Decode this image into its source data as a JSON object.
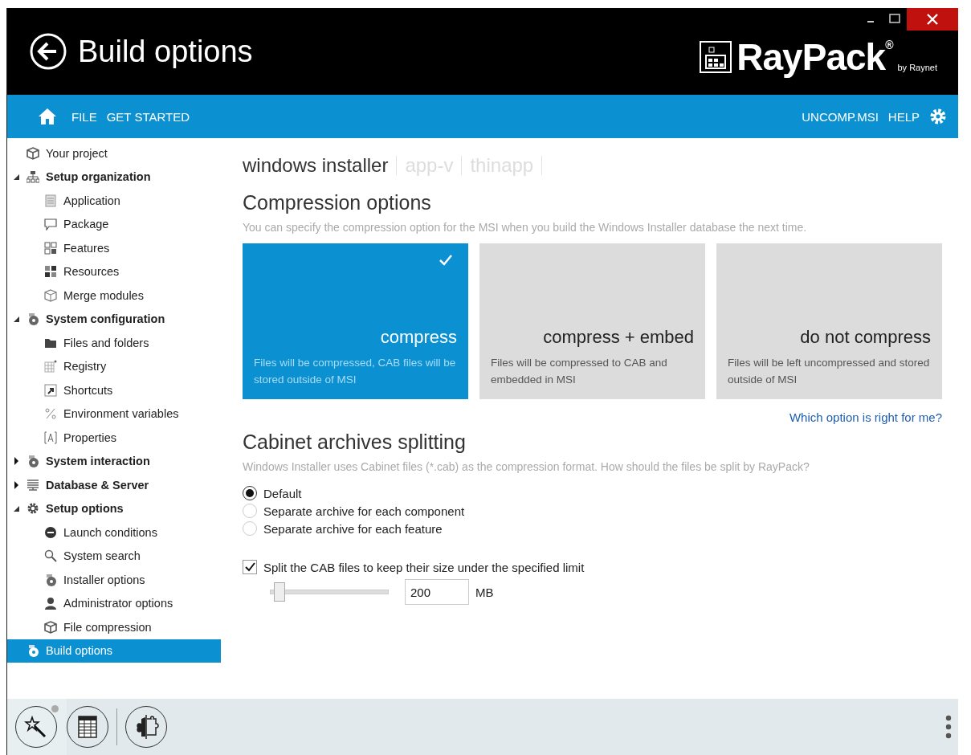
{
  "window": {
    "title": "Build options",
    "logo": "RayPack$^{®}$",
    "logo_byline": "by Raynet"
  },
  "nav": {
    "left": [
      "FILE",
      "GET STARTED"
    ],
    "right": [
      "UNCOMP.MSI",
      "HELP"
    ]
  },
  "sidebar": {
    "items": [
      {
        "label": "Your project",
        "bold": false,
        "selected": false
      },
      {
        "label": "Setup organization",
        "bold": true,
        "expanded": true,
        "selected": false,
        "children": [
          {
            "label": "Application",
            "selected": false
          },
          {
            "label": "Package",
            "selected": false
          },
          {
            "label": "Features",
            "selected": false
          },
          {
            "label": "Resources",
            "selected": false
          },
          {
            "label": "Merge modules",
            "selected": false
          }
        ]
      },
      {
        "label": "System configuration",
        "bold": true,
        "expanded": true,
        "selected": false,
        "children": [
          {
            "label": "Files and folders",
            "selected": false
          },
          {
            "label": "Registry",
            "selected": false
          },
          {
            "label": "Shortcuts",
            "selected": false
          },
          {
            "label": "Environment variables",
            "selected": false
          },
          {
            "label": "Properties",
            "selected": false
          }
        ]
      },
      {
        "label": "System interaction",
        "bold": true,
        "expanded": false,
        "selected": false
      },
      {
        "label": "Database & Server",
        "bold": true,
        "expanded": false,
        "selected": false
      },
      {
        "label": "Setup options",
        "bold": true,
        "expanded": true,
        "selected": false,
        "children": [
          {
            "label": "Launch conditions",
            "selected": false
          },
          {
            "label": "System search",
            "selected": false
          },
          {
            "label": "Installer options",
            "selected": false
          },
          {
            "label": "Administrator options",
            "selected": false
          },
          {
            "label": "File compression",
            "selected": false
          }
        ]
      },
      {
        "label": "Build options",
        "bold": false,
        "selected": true
      }
    ]
  },
  "tabs": [
    {
      "label": "windows installer",
      "selected": true
    },
    {
      "label": "app-v",
      "selected": false
    },
    {
      "label": "thinapp",
      "selected": false
    }
  ],
  "compression": {
    "heading": "Compression options",
    "description": "You can specify the compression option for the MSI when you build the Windows Installer database the next time.",
    "options": [
      {
        "title": "compress",
        "text": "Files will be compressed, CAB files will be stored outside of MSI",
        "selected": true
      },
      {
        "title": "compress + embed",
        "text": "Files will be compressed to CAB and embedded in MSI",
        "selected": false
      },
      {
        "title": "do not compress",
        "text": "Files will be left uncompressed and stored outside of MSI",
        "selected": false
      }
    ],
    "help_link": "Which option is right for me?"
  },
  "splitting": {
    "heading": "Cabinet archives splitting",
    "description": "Windows Installer uses Cabinet files (*.cab) as the compression format. How should the files be split by RayPack?",
    "radios": [
      {
        "label": "Default",
        "selected": true
      },
      {
        "label": "Separate archive for each component",
        "selected": false
      },
      {
        "label": "Separate archive for each feature",
        "selected": false
      }
    ],
    "limit": {
      "label": "Split the CAB files to keep their size under the specified limit",
      "checked": true,
      "level": 0.08,
      "value": "200",
      "unit": "MB"
    }
  }
}
